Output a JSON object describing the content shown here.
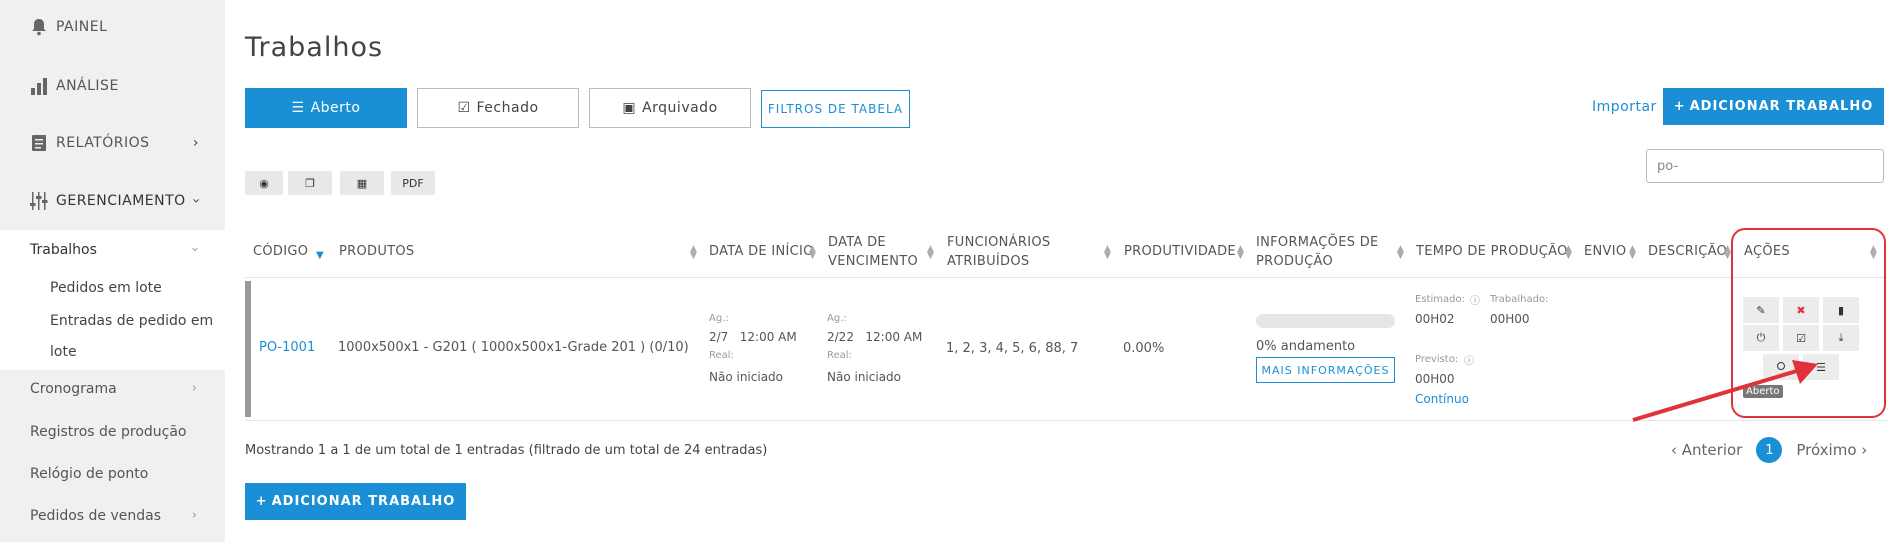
{
  "sidebar": {
    "painel": "PAINEL",
    "analise": "ANÁLISE",
    "relatorios": "RELATÓRIOS",
    "gerenciamento": "GERENCIAMENTO",
    "trabalhos": "Trabalhos",
    "pedidos_lote": "Pedidos em lote",
    "entradas_l1": "Entradas de pedido em",
    "entradas_l2": "lote",
    "cronograma": "Cronograma",
    "registros": "Registros de produção",
    "relogio": "Relógio de ponto",
    "pedidos_vendas": "Pedidos de vendas"
  },
  "page": {
    "title": "Trabalhos"
  },
  "tabs": {
    "aberto": "Aberto",
    "fechado": "Fechado",
    "arquivado": "Arquivado"
  },
  "toolbar": {
    "filtros": "FILTROS DE TABELA",
    "importar": "Importar",
    "adicionar": "ADICIONAR TRABALHO",
    "search_value": "po-",
    "pdf": "PDF"
  },
  "table": {
    "headers": {
      "codigo": "CÓDIGO",
      "produtos": "PRODUTOS",
      "data_inicio": "DATA DE INÍCIO",
      "data_venc_1": "DATA DE",
      "data_venc_2": "VENCIMENTO",
      "func_1": "FUNCIONÁRIOS",
      "func_2": "ATRIBUÍDOS",
      "produtividade": "PRODUTIVIDADE",
      "info_1": "INFORMAÇÕES DE",
      "info_2": "PRODUÇÃO",
      "tempo": "TEMPO DE PRODUÇÃO",
      "envio": "ENVIO",
      "descricao": "DESCRIÇÃO",
      "acoes": "AÇÕES"
    },
    "row": {
      "codigo": "PO-1001",
      "produtos": "1000x500x1 - G201 ( 1000x500x1-Grade 201 ) (0/10)",
      "ag_label": "Ag.:",
      "inicio_ag": "2/7   12:00 AM",
      "real_label": "Real:",
      "inicio_real": "Não iniciado",
      "venc_ag": "2/22   12:00 AM",
      "venc_real": "Não iniciado",
      "funcionarios": "1, 2, 3, 4, 5, 6, 88, 7",
      "produtividade": "0.00%",
      "progress_pct": 0,
      "andamento": "0% andamento",
      "mais_info": "MAIS INFORMAÇÕES",
      "estimado_label": "Estimado:",
      "estimado": "00H02",
      "trabalhado_label": "Trabalhado:",
      "trabalhado": "00H00",
      "previsto_label": "Previsto:",
      "previsto": "00H00",
      "continuo": "Contínuo",
      "tooltip": "Aberto"
    }
  },
  "footer": {
    "info": "Mostrando 1 a 1 de um total de 1 entradas (filtrado de um total de 24 entradas)",
    "anterior": "Anterior",
    "page": "1",
    "proximo": "Próximo",
    "adicionar": "ADICIONAR TRABALHO"
  },
  "colors": {
    "accent": "#1a8fd6",
    "highlight": "#e0323a"
  }
}
